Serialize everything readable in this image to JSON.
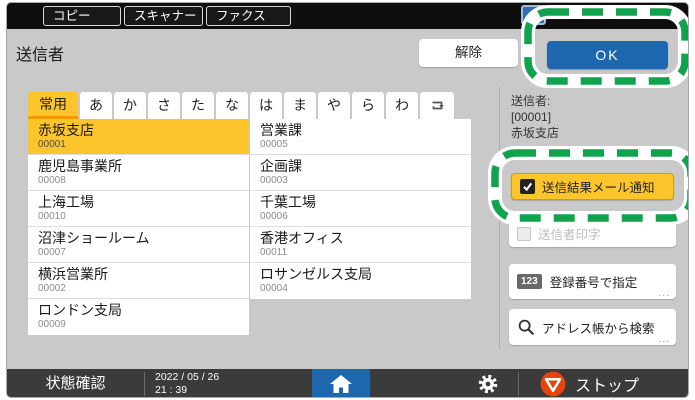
{
  "app_tabs": [
    "コピー",
    "スキャナー",
    "ファクス"
  ],
  "header": {
    "title": "送信者",
    "release": "解除",
    "ok": "OK"
  },
  "index_tabs": [
    "常用",
    "あ",
    "か",
    "さ",
    "た",
    "な",
    "は",
    "ま",
    "や",
    "ら",
    "わ"
  ],
  "address_list": {
    "left": [
      {
        "name": "赤坂支店",
        "code": "00001"
      },
      {
        "name": "鹿児島事業所",
        "code": "00008"
      },
      {
        "name": "上海工場",
        "code": "00010"
      },
      {
        "name": "沼津ショールーム",
        "code": "00007"
      },
      {
        "name": "横浜営業所",
        "code": "00002"
      },
      {
        "name": "ロンドン支局",
        "code": "00009"
      }
    ],
    "right": [
      {
        "name": "営業課",
        "code": "00005"
      },
      {
        "name": "企画課",
        "code": "00003"
      },
      {
        "name": "千葉工場",
        "code": "00006"
      },
      {
        "name": "香港オフィス",
        "code": "00011"
      },
      {
        "name": "ロサンゼルス支局",
        "code": "00004"
      }
    ]
  },
  "sidebar": {
    "sender_label": "送信者:",
    "sender_code": "[00001]",
    "sender_name": "赤坂支店",
    "mail_notify": "送信結果メール通知",
    "sender_print": "送信者印字",
    "register_badge": "123",
    "register_number": "登録番号で指定",
    "search_addressbook": "アドレス帳から検索",
    "more": "..."
  },
  "footer": {
    "status": "状態確認",
    "date": "2022 / 05 / 26",
    "time": "21 : 39",
    "stop": "ストップ"
  },
  "colors": {
    "accent_yellow": "#fcc52c",
    "ok_blue": "#1e66ad",
    "annotation_green": "#10a24c",
    "stop_orange": "#e8430a",
    "bar_dark": "#3b3b3b"
  }
}
